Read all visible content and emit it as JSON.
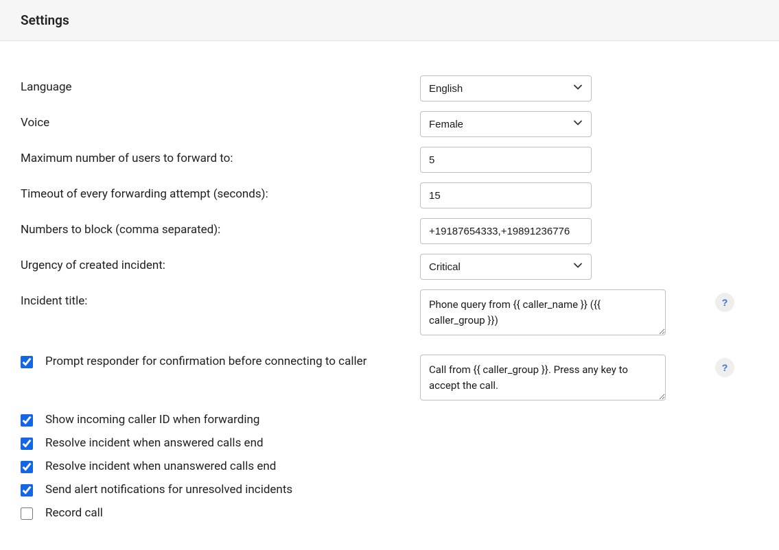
{
  "header": {
    "title": "Settings"
  },
  "fields": {
    "language": {
      "label": "Language",
      "value": "English"
    },
    "voice": {
      "label": "Voice",
      "value": "Female"
    },
    "max_users": {
      "label": "Maximum number of users to forward to:",
      "value": "5"
    },
    "timeout": {
      "label": "Timeout of every forwarding attempt (seconds):",
      "value": "15"
    },
    "blocked_numbers": {
      "label": "Numbers to block (comma separated):",
      "value": "+19187654333,+19891236776"
    },
    "urgency": {
      "label": "Urgency of created incident:",
      "value": "Critical"
    },
    "incident_title": {
      "label": "Incident title:",
      "value": "Phone query from {{ caller_name }} ({{ caller_group }})"
    }
  },
  "checkboxes": {
    "prompt_responder": {
      "label": "Prompt responder for confirmation before connecting to caller",
      "checked": true,
      "textarea_value": "Call from {{ caller_group }}. Press any key to accept the call."
    },
    "show_caller_id": {
      "label": "Show incoming caller ID when forwarding",
      "checked": true
    },
    "resolve_answered": {
      "label": "Resolve incident when answered calls end",
      "checked": true
    },
    "resolve_unanswered": {
      "label": "Resolve incident when unanswered calls end",
      "checked": true
    },
    "send_alerts": {
      "label": "Send alert notifications for unresolved incidents",
      "checked": true
    },
    "record_call": {
      "label": "Record call",
      "checked": false
    }
  },
  "help": {
    "text": "?"
  }
}
